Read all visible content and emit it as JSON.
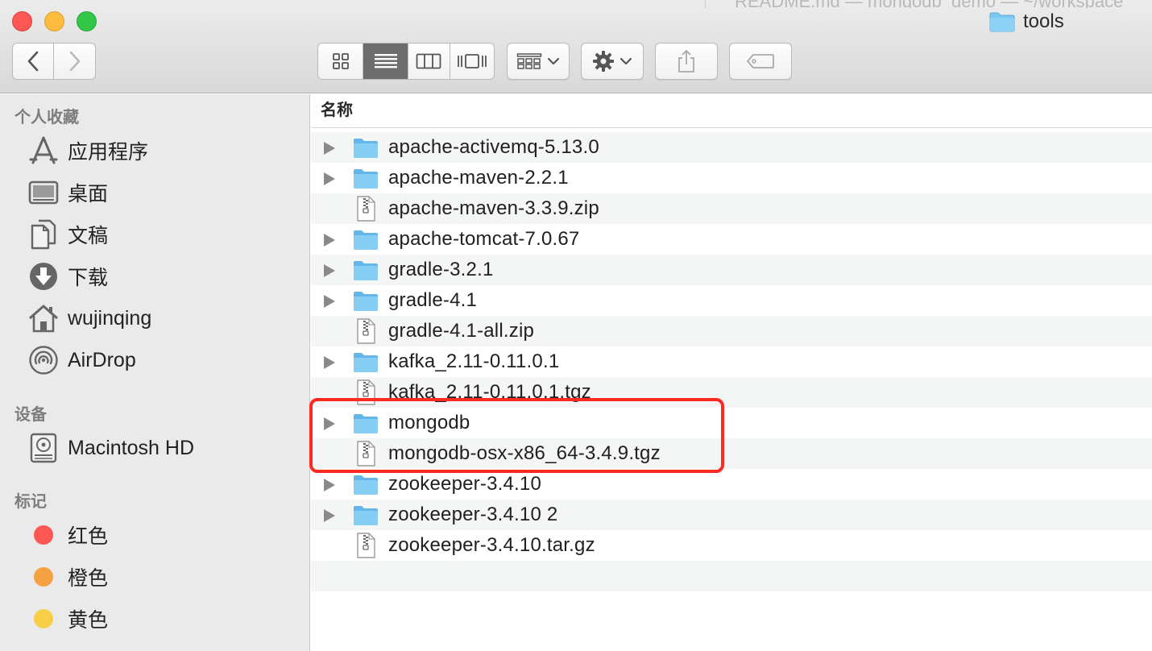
{
  "window": {
    "title": "tools",
    "background_hint": "README.md — mongodb_demo — ~/workspace"
  },
  "toolbar": {
    "back": "back",
    "forward": "forward",
    "views": [
      "icon-view",
      "list-view",
      "column-view",
      "cover-flow-view"
    ],
    "active_view": "list-view",
    "arrange": "arrange",
    "action": "action",
    "share": "share",
    "tags": "tags"
  },
  "sidebar": {
    "favorites_title": "个人收藏",
    "favorites": [
      {
        "label": "应用程序",
        "icon": "applications-icon"
      },
      {
        "label": "桌面",
        "icon": "desktop-icon"
      },
      {
        "label": "文稿",
        "icon": "documents-icon"
      },
      {
        "label": "下载",
        "icon": "downloads-icon"
      },
      {
        "label": "wujinqing",
        "icon": "home-icon"
      },
      {
        "label": "AirDrop",
        "icon": "airdrop-icon"
      }
    ],
    "devices_title": "设备",
    "devices": [
      {
        "label": "Macintosh HD",
        "icon": "disk-icon"
      }
    ],
    "tags_title": "标记",
    "tags": [
      {
        "label": "红色",
        "color": "#fc5753"
      },
      {
        "label": "橙色",
        "color": "#f4a142"
      },
      {
        "label": "黄色",
        "color": "#f6cf46"
      }
    ]
  },
  "list": {
    "column_name": "名称",
    "rows": [
      {
        "name": "apache-activemq-5.13.0",
        "type": "folder"
      },
      {
        "name": "apache-maven-2.2.1",
        "type": "folder"
      },
      {
        "name": "apache-maven-3.3.9.zip",
        "type": "archive"
      },
      {
        "name": "apache-tomcat-7.0.67",
        "type": "folder"
      },
      {
        "name": "gradle-3.2.1",
        "type": "folder"
      },
      {
        "name": "gradle-4.1",
        "type": "folder"
      },
      {
        "name": "gradle-4.1-all.zip",
        "type": "archive"
      },
      {
        "name": "kafka_2.11-0.11.0.1",
        "type": "folder"
      },
      {
        "name": "kafka_2.11-0.11.0.1.tgz",
        "type": "archive"
      },
      {
        "name": "mongodb",
        "type": "folder"
      },
      {
        "name": "mongodb-osx-x86_64-3.4.9.tgz",
        "type": "archive"
      },
      {
        "name": "zookeeper-3.4.10",
        "type": "folder"
      },
      {
        "name": "zookeeper-3.4.10 2",
        "type": "folder"
      },
      {
        "name": "zookeeper-3.4.10.tar.gz",
        "type": "archive"
      }
    ]
  },
  "colors": {
    "folder": "#7cc7f1",
    "highlight": "#ff2a1f",
    "sidebar_bg": "#eaeaea"
  }
}
